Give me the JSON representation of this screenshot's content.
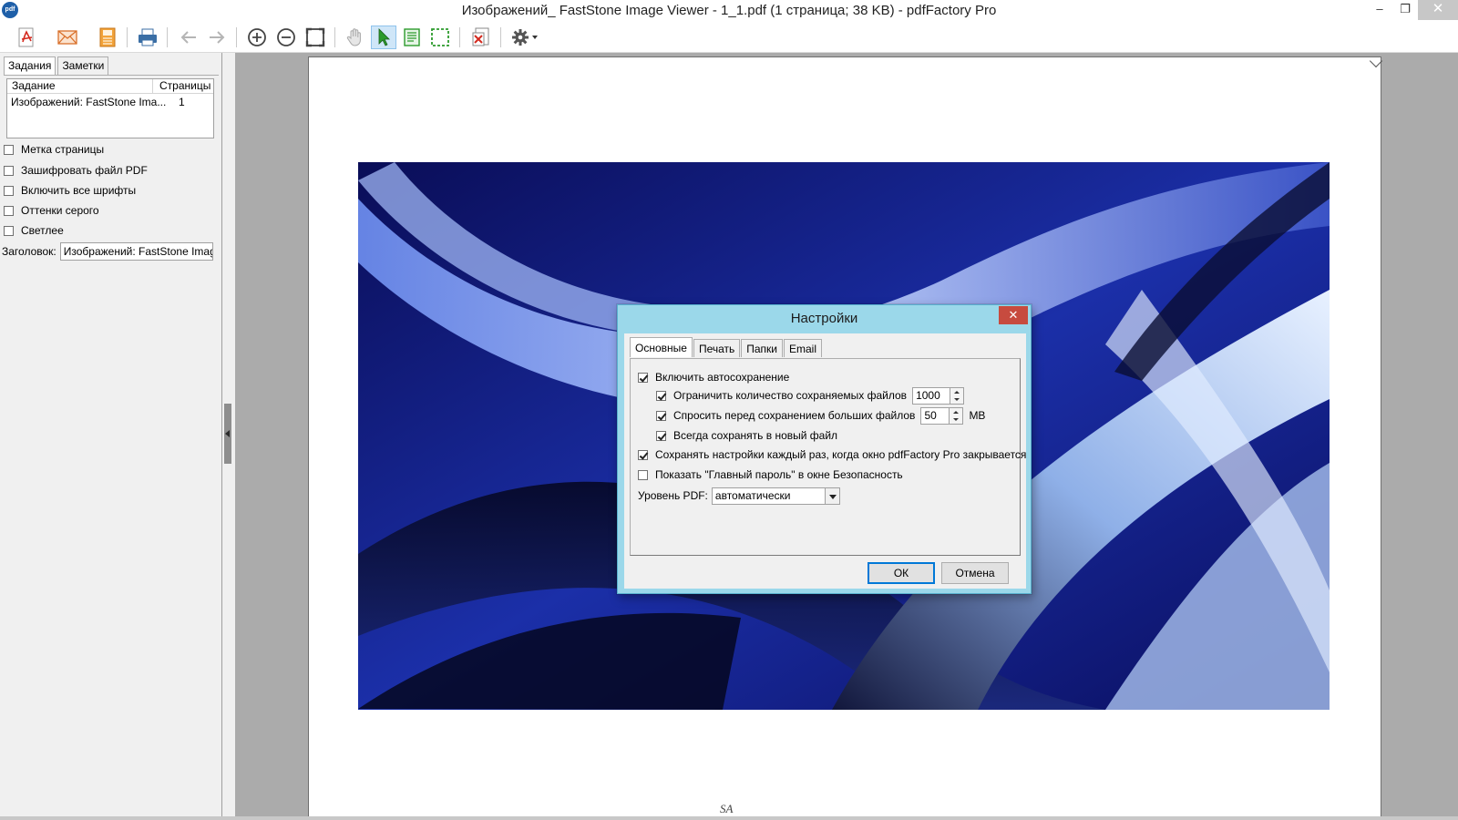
{
  "window": {
    "app_icon": "pdf",
    "title": "Изображений_ FastStone Image Viewer - 1_1.pdf (1 страница; 38 KB) - pdfFactory Pro",
    "minimize": "‒",
    "maximize": "❐",
    "close": "✕"
  },
  "toolbar": {
    "icons": [
      "pdf-save-icon",
      "email-icon",
      "save-icon",
      "print-icon",
      "back-icon",
      "forward-icon",
      "zoom-in-icon",
      "zoom-out-icon",
      "fit-page-icon",
      "hand-icon",
      "select-pointer-icon",
      "select-text-icon",
      "select-area-icon",
      "delete-page-icon",
      "settings-icon"
    ]
  },
  "left_panel": {
    "tabs": [
      "Задания",
      "Заметки"
    ],
    "job_list": {
      "columns": [
        "Задание",
        "Страницы"
      ],
      "rows": [
        {
          "name": "Изображений: FastStone Ima...",
          "pages": "1"
        }
      ]
    },
    "options": [
      {
        "label": "Метка страницы",
        "checked": false
      },
      {
        "label": "Зашифровать файл PDF",
        "checked": false
      },
      {
        "label": "Включить все шрифты",
        "checked": false
      },
      {
        "label": "Оттенки серого",
        "checked": false
      },
      {
        "label": "Светлее",
        "checked": false
      }
    ],
    "header_label": "Заголовок:",
    "header_value": "Изображений: FastStone Image V"
  },
  "document": {
    "footer_mark": "SA"
  },
  "dialog": {
    "title": "Настройки",
    "close": "✕",
    "tabs": [
      "Основные",
      "Печать",
      "Папки",
      "Email"
    ],
    "autosave_label": "Включить автосохранение",
    "limit_label": "Ограничить количество сохраняемых файлов",
    "limit_value": "1000",
    "ask_label": "Спросить перед сохранением больших файлов",
    "ask_value": "50",
    "ask_unit": "MB",
    "new_file_label": "Всегда сохранять в новый файл",
    "save_settings_label": "Сохранять настройки каждый раз, когда окно pdfFactory Pro закрывается",
    "show_password_label": "Показать \"Главный пароль\" в окне Безопасность",
    "pdf_level_label": "Уровень PDF:",
    "pdf_level_value": "автоматически",
    "ok": "ОК",
    "cancel": "Отмена",
    "checks": {
      "autosave": true,
      "limit": true,
      "ask": true,
      "new_file": true,
      "save_settings": true,
      "show_password": false
    }
  }
}
